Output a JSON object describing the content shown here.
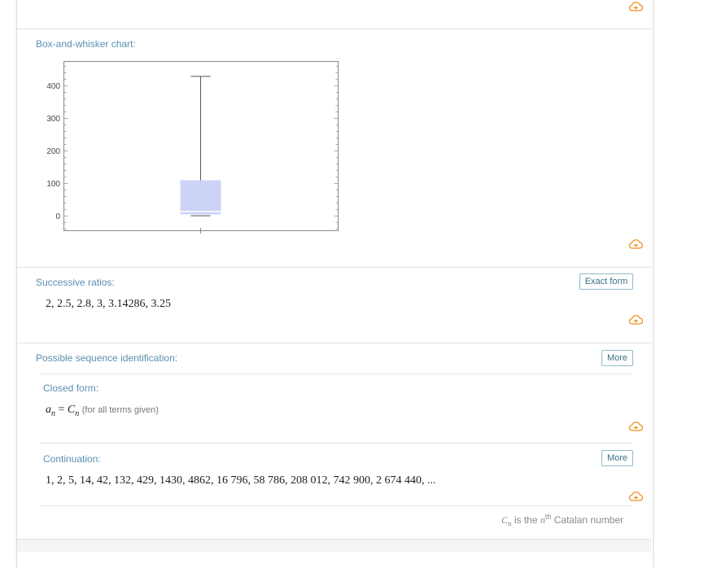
{
  "colors": {
    "accent_orange": "#f08c1e",
    "title_blue": "#5a8fb1",
    "button_border": "#8fb9c9",
    "box_fill": "#ccd3f7"
  },
  "box_chart": {
    "title": "Box-and-whisker chart:",
    "y_ticks": [
      "0",
      "100",
      "200",
      "300",
      "400"
    ]
  },
  "chart_data": {
    "type": "box",
    "ylim": [
      -45,
      475
    ],
    "y_ticks": [
      0,
      100,
      200,
      300,
      400
    ],
    "boxes": [
      {
        "min": 1,
        "q1": 5,
        "median": 14,
        "q3": 110,
        "max": 429
      }
    ],
    "grid": false
  },
  "successive_ratios": {
    "title": "Successive ratios:",
    "button": "Exact form",
    "value": "2, 2.5, 2.8, 3, 3.14286, 3.25"
  },
  "sequence_id": {
    "title": "Possible sequence identification:",
    "button": "More",
    "closed_form": {
      "title": "Closed form:",
      "lhs_var": "a",
      "lhs_sub": "n",
      "eq": " = ",
      "rhs_var": "C",
      "rhs_sub": "n",
      "note": "(for all terms given)"
    },
    "continuation": {
      "title": "Continuation:",
      "button": "More",
      "value": "1, 2, 5, 14, 42, 132, 429, 1430, 4862, 16 796, 58 786, 208 012, 742 900, 2 674 440, ..."
    },
    "footnote": {
      "var": "C",
      "sub": "n",
      "pre": " is the ",
      "n": "n",
      "sup": "th",
      "post": " Catalan number"
    }
  }
}
